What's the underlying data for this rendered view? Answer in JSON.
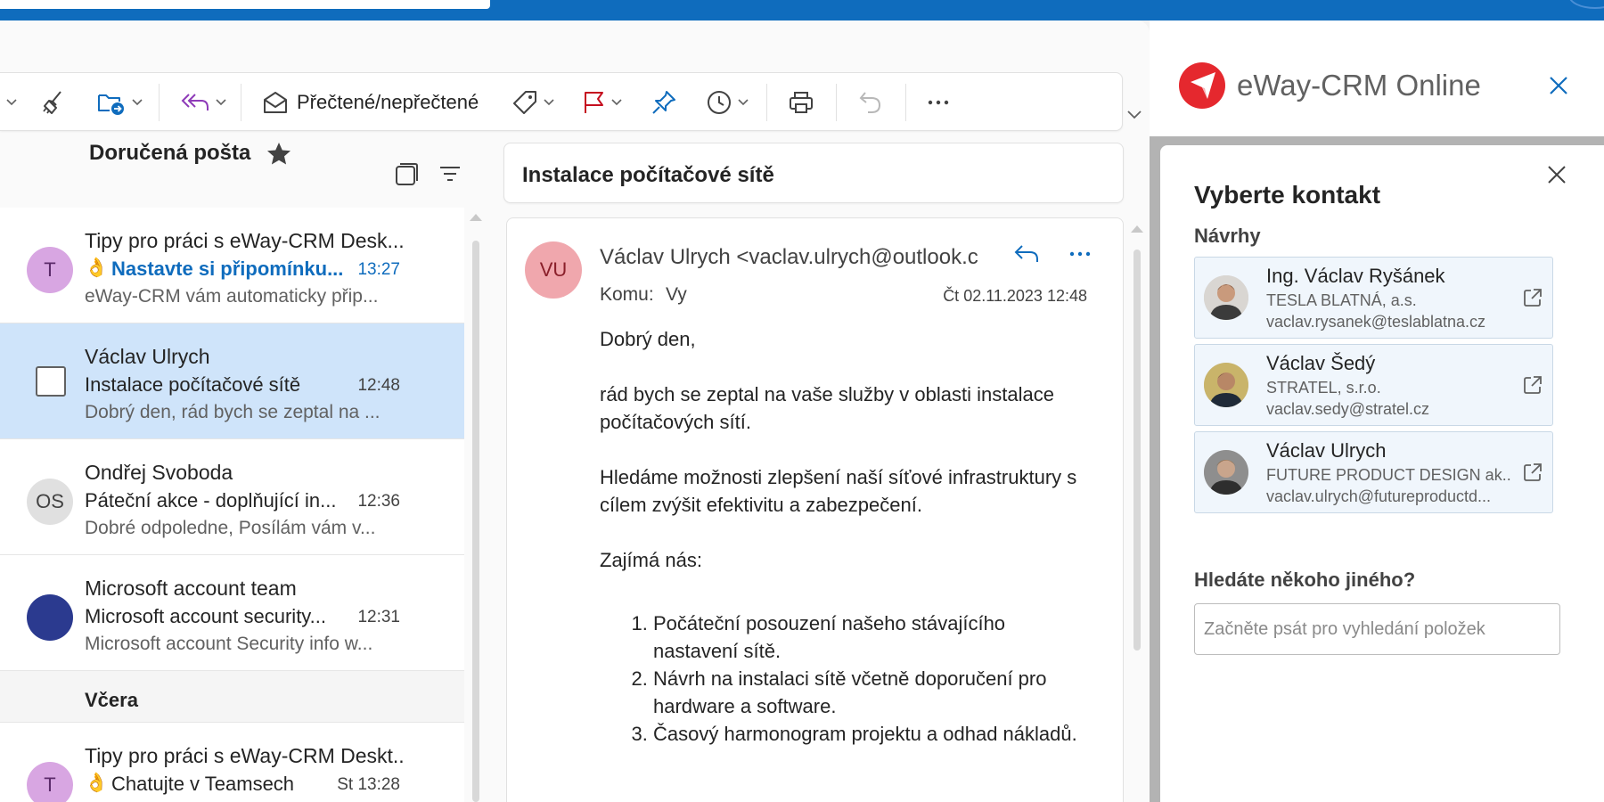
{
  "toolbar": {
    "read_unread_label": "Přečtené/nepřečtené"
  },
  "inbox": {
    "title": "Doručená pošta",
    "messages": [
      {
        "avatar": "T",
        "from": "Tipy pro práci s eWay-CRM Desk...",
        "emoji": "👌",
        "subject": "Nastavte si připomínku...",
        "time": "13:27",
        "preview": "eWay-CRM vám automaticky přip..."
      },
      {
        "from": "Václav Ulrych",
        "subject": "Instalace počítačové sítě",
        "time": "12:48",
        "preview": "Dobrý den, rád bych se zeptal na ..."
      },
      {
        "avatar": "OS",
        "from": "Ondřej Svoboda",
        "subject": "Páteční akce - doplňující in...",
        "time": "12:36",
        "preview": "Dobré odpoledne, Posílám vám v..."
      },
      {
        "from": "Microsoft account team",
        "subject": "Microsoft account security...",
        "time": "12:31",
        "preview": "Microsoft account Security info w..."
      }
    ],
    "group_yesterday": "Včera",
    "yesterday_messages": [
      {
        "avatar": "T",
        "from": "Tipy pro práci s eWay-CRM Deskt...",
        "emoji": "👌",
        "subject": "Chatujte v Teamsech",
        "time": "St 13:28"
      }
    ]
  },
  "reading": {
    "subject": "Instalace počítačové sítě",
    "avatar": "VU",
    "from": "Václav Ulrych <vaclav.ulrych@outlook.c",
    "to_label": "Komu:",
    "to": "Vy",
    "date": "Čt 02.11.2023 12:48",
    "body": {
      "greeting": "Dobrý den,",
      "para1": "rád bych se zeptal na vaše služby v oblasti instalace počítačových sítí.",
      "para2": "Hledáme možnosti zlepšení naší síťové infrastruktury s cílem zvýšit efektivitu a zabezpečení.",
      "para3": "Zajímá nás:",
      "list": [
        "Počáteční posouzení našeho stávajícího nastavení sítě.",
        "Návrh na instalaci sítě včetně doporučení pro hardware a software.",
        "Časový harmonogram projektu a odhad nákladů."
      ]
    }
  },
  "addin": {
    "title": "eWay-CRM Online",
    "panel_title": "Vyberte kontakt",
    "suggestions_label": "Návrhy",
    "contacts": [
      {
        "name": "Ing. Václav Ryšánek",
        "company": "TESLA BLATNÁ, a.s.",
        "email": "vaclav.rysanek@teslablatna.cz"
      },
      {
        "name": "Václav Šedý",
        "company": "STRATEL, s.r.o.",
        "email": "vaclav.sedy@stratel.cz"
      },
      {
        "name": "Václav Ulrych",
        "company": "FUTURE PRODUCT DESIGN ak...",
        "email": "vaclav.ulrych@futureproductd..."
      }
    ],
    "other_label": "Hledáte někoho jiného?",
    "search_placeholder": "Začněte psát pro vyhledání položek"
  },
  "colors": {
    "brand": "#0f6cbd",
    "selected_row": "#cfe4fa",
    "eway_red": "#e5282e"
  }
}
